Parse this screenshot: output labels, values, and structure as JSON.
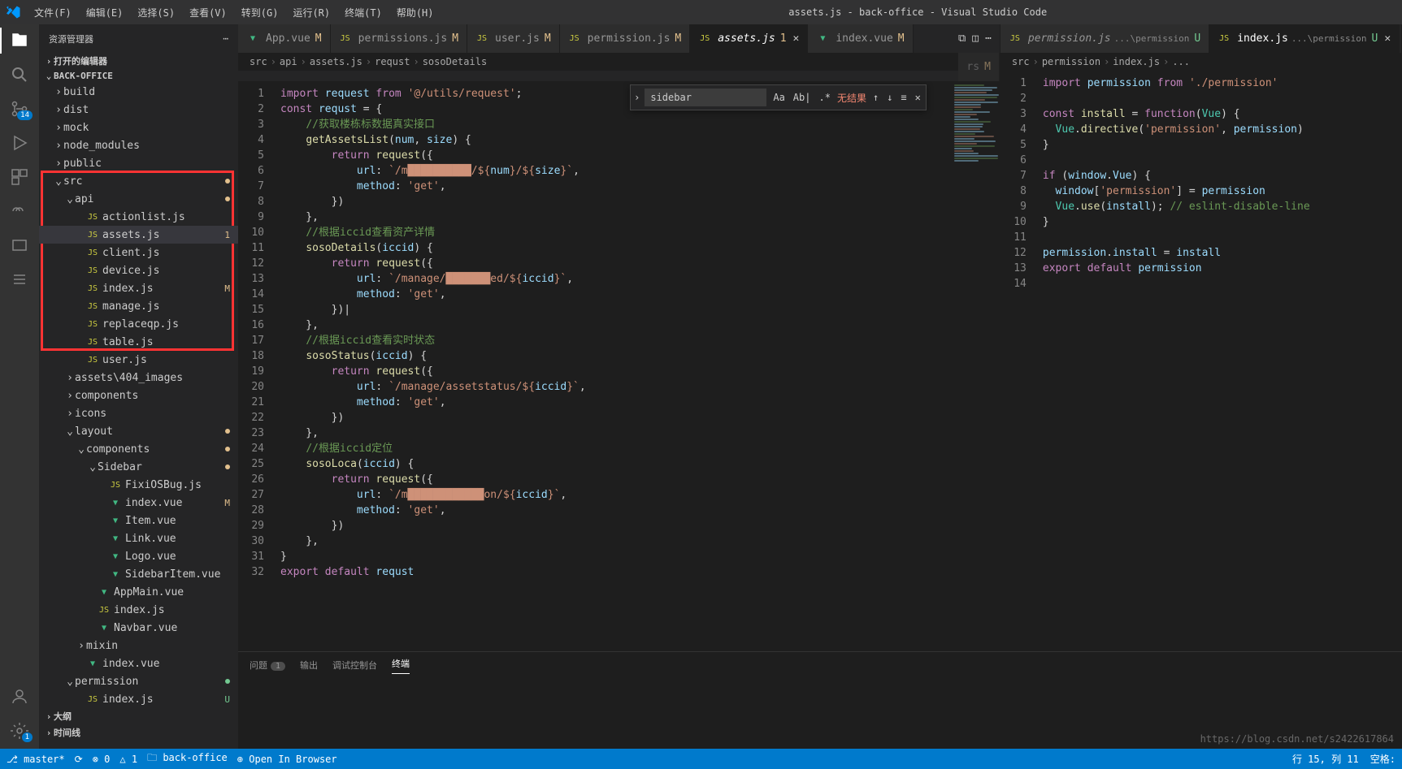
{
  "window_title": "assets.js - back-office - Visual Studio Code",
  "menus": [
    "文件(F)",
    "编辑(E)",
    "选择(S)",
    "查看(V)",
    "转到(G)",
    "运行(R)",
    "终端(T)",
    "帮助(H)"
  ],
  "activity_badge_scm": "14",
  "activity_badge_settings": "1",
  "sidebar": {
    "title": "资源管理器",
    "section_open": "打开的编辑器",
    "project": "BACK-OFFICE",
    "outline": "大纲",
    "timeline": "时间线"
  },
  "tree": [
    {
      "indent": 0,
      "chev": "›",
      "name": "build",
      "type": "folder"
    },
    {
      "indent": 0,
      "chev": "›",
      "name": "dist",
      "type": "folder"
    },
    {
      "indent": 0,
      "chev": "›",
      "name": "mock",
      "type": "folder"
    },
    {
      "indent": 0,
      "chev": "›",
      "name": "node_modules",
      "type": "folder"
    },
    {
      "indent": 0,
      "chev": "›",
      "name": "public",
      "type": "folder"
    },
    {
      "indent": 0,
      "chev": "⌄",
      "name": "src",
      "type": "folder",
      "dotY": true
    },
    {
      "indent": 1,
      "chev": "⌄",
      "name": "api",
      "type": "folder",
      "dotY": true
    },
    {
      "indent": 2,
      "icon": "js",
      "name": "actionlist.js",
      "type": "file"
    },
    {
      "indent": 2,
      "icon": "js",
      "name": "assets.js",
      "type": "file",
      "active": true,
      "mod": "1"
    },
    {
      "indent": 2,
      "icon": "js",
      "name": "client.js",
      "type": "file"
    },
    {
      "indent": 2,
      "icon": "js",
      "name": "device.js",
      "type": "file"
    },
    {
      "indent": 2,
      "icon": "js",
      "name": "index.js",
      "type": "file",
      "mod": "M"
    },
    {
      "indent": 2,
      "icon": "js",
      "name": "manage.js",
      "type": "file"
    },
    {
      "indent": 2,
      "icon": "js",
      "name": "replaceqp.js",
      "type": "file"
    },
    {
      "indent": 2,
      "icon": "js",
      "name": "table.js",
      "type": "file"
    },
    {
      "indent": 2,
      "icon": "js",
      "name": "user.js",
      "type": "file"
    },
    {
      "indent": 1,
      "chev": "›",
      "name": "assets\\404_images",
      "type": "folder"
    },
    {
      "indent": 1,
      "chev": "›",
      "name": "components",
      "type": "folder"
    },
    {
      "indent": 1,
      "chev": "›",
      "name": "icons",
      "type": "folder"
    },
    {
      "indent": 1,
      "chev": "⌄",
      "name": "layout",
      "type": "folder",
      "dotY": true
    },
    {
      "indent": 2,
      "chev": "⌄",
      "name": "components",
      "type": "folder",
      "dotY": true
    },
    {
      "indent": 3,
      "chev": "⌄",
      "name": "Sidebar",
      "type": "folder",
      "dotY": true
    },
    {
      "indent": 4,
      "icon": "js",
      "name": "FixiOSBug.js",
      "type": "file"
    },
    {
      "indent": 4,
      "icon": "vue",
      "name": "index.vue",
      "type": "file",
      "mod": "M"
    },
    {
      "indent": 4,
      "icon": "vue",
      "name": "Item.vue",
      "type": "file"
    },
    {
      "indent": 4,
      "icon": "vue",
      "name": "Link.vue",
      "type": "file"
    },
    {
      "indent": 4,
      "icon": "vue",
      "name": "Logo.vue",
      "type": "file"
    },
    {
      "indent": 4,
      "icon": "vue",
      "name": "SidebarItem.vue",
      "type": "file"
    },
    {
      "indent": 3,
      "icon": "vue",
      "name": "AppMain.vue",
      "type": "file"
    },
    {
      "indent": 3,
      "icon": "js",
      "name": "index.js",
      "type": "file"
    },
    {
      "indent": 3,
      "icon": "vue",
      "name": "Navbar.vue",
      "type": "file"
    },
    {
      "indent": 2,
      "chev": "›",
      "name": "mixin",
      "type": "folder"
    },
    {
      "indent": 2,
      "icon": "vue",
      "name": "index.vue",
      "type": "file"
    },
    {
      "indent": 1,
      "chev": "⌄",
      "name": "permission",
      "type": "folder",
      "dotG": true
    },
    {
      "indent": 2,
      "icon": "js",
      "name": "index.js",
      "type": "file",
      "mod": "U",
      "modGreen": true
    }
  ],
  "tabs_left": [
    {
      "icon": "vue",
      "name": "App.vue",
      "mod": "M"
    },
    {
      "icon": "js",
      "name": "permissions.js",
      "mod": "M"
    },
    {
      "icon": "js",
      "name": "user.js",
      "mod": "M"
    },
    {
      "icon": "js",
      "name": "permission.js",
      "mod": "M"
    },
    {
      "icon": "js",
      "name": "assets.js",
      "mod": "1",
      "active": true,
      "close": true,
      "italic": true
    },
    {
      "icon": "vue",
      "name": "index.vue",
      "mod": "M"
    }
  ],
  "tabs_right": [
    {
      "icon": "js",
      "name": "permission.js",
      "path": "...\\permission",
      "mod": "U",
      "italic": true
    },
    {
      "icon": "js",
      "name": "index.js",
      "path": "...\\permission",
      "mod": "U",
      "active": true,
      "close": true
    }
  ],
  "tabs_overflow": {
    "name": "rs",
    "mod": "M"
  },
  "breadcrumb_left": [
    "src",
    "api",
    "assets.js",
    "requst",
    "sosoDetails"
  ],
  "breadcrumb_right": [
    "src",
    "permission",
    "index.js",
    "..."
  ],
  "find": {
    "value": "sidebar",
    "no_result": "无结果",
    "opts": [
      "Aa",
      "Ab|",
      ".*"
    ]
  },
  "code_left": [
    "<span class='kw'>import</span> <span class='var'>request</span> <span class='kw'>from</span> <span class='str'>'@/utils/request'</span>;",
    "<span class='kw'>const</span> <span class='var'>requst</span> = {",
    "    <span class='com'>//获取楼栋标数据真实接口</span>",
    "    <span class='fn'>getAssetsList</span>(<span class='var'>num</span>, <span class='var'>size</span>) {",
    "        <span class='kw'>return</span> <span class='fn'>request</span>({",
    "            <span class='var'>url</span>: <span class='str'>`/m██████████/${</span><span class='var'>num</span><span class='str'>}/${</span><span class='var'>size</span><span class='str'>}`</span>,",
    "            <span class='var'>method</span>: <span class='str'>'get'</span>,",
    "        })",
    "    },",
    "    <span class='com'>//根据iccid查看资产详情</span>",
    "    <span class='fn'>sosoDetails</span>(<span class='var'>iccid</span>) {",
    "        <span class='kw'>return</span> <span class='fn'>request</span>({",
    "            <span class='var'>url</span>: <span class='str'>`/manage/███████ed/${</span><span class='var'>iccid</span><span class='str'>}`</span>,",
    "            <span class='var'>method</span>: <span class='str'>'get'</span>,",
    "        })|",
    "    },",
    "    <span class='com'>//根据iccid查看实时状态</span>",
    "    <span class='fn'>sosoStatus</span>(<span class='var'>iccid</span>) {",
    "        <span class='kw'>return</span> <span class='fn'>request</span>({",
    "            <span class='var'>url</span>: <span class='str'>`/manage/assetstatus/${</span><span class='var'>iccid</span><span class='str'>}`</span>,",
    "            <span class='var'>method</span>: <span class='str'>'get'</span>,",
    "        })",
    "    },",
    "    <span class='com'>//根据iccid定位</span>",
    "    <span class='fn'>sosoLoca</span>(<span class='var'>iccid</span>) {",
    "        <span class='kw'>return</span> <span class='fn'>request</span>({",
    "            <span class='var'>url</span>: <span class='str'>`/m████████████on/${</span><span class='var'>iccid</span><span class='str'>}`</span>,",
    "            <span class='var'>method</span>: <span class='str'>'get'</span>,",
    "        })",
    "    },",
    "}",
    "<span class='kw'>export</span> <span class='kw'>default</span> <span class='var'>requst</span>"
  ],
  "code_right": [
    "<span class='kw'>import</span> <span class='var'>permission</span> <span class='kw'>from</span> <span class='str'>'./permission'</span>",
    "",
    "<span class='kw'>const</span> <span class='fn'>install</span> = <span class='kw'>function</span>(<span class='type'>Vue</span>) {",
    "  <span class='type'>Vue</span>.<span class='fn'>directive</span>(<span class='str'>'permission'</span>, <span class='var'>permission</span>)",
    "}",
    "",
    "<span class='kw'>if</span> (<span class='var'>window</span>.<span class='var'>Vue</span>) {",
    "  <span class='var'>window</span>[<span class='str'>'permission'</span>] = <span class='var'>permission</span>",
    "  <span class='type'>Vue</span>.<span class='fn'>use</span>(<span class='var'>install</span>); <span class='com'>// eslint-disable-line</span>",
    "}",
    "",
    "<span class='var'>permission</span>.<span class='var'>install</span> = <span class='var'>install</span>",
    "<span class='kw'>export</span> <span class='kw'>default</span> <span class='var'>permission</span>",
    ""
  ],
  "panel": {
    "tabs": [
      {
        "label": "问题",
        "count": "1"
      },
      {
        "label": "输出"
      },
      {
        "label": "调试控制台"
      },
      {
        "label": "终端",
        "active": true
      }
    ]
  },
  "status": {
    "branch": "master*",
    "sync": "⟳",
    "errors": "⊗ 0",
    "warnings": "△ 1",
    "folder": "back-office",
    "browser": "Open In Browser",
    "cursor": "行 15, 列 11",
    "spaces": "空格:"
  },
  "watermark": "https://blog.csdn.net/s2422617864"
}
